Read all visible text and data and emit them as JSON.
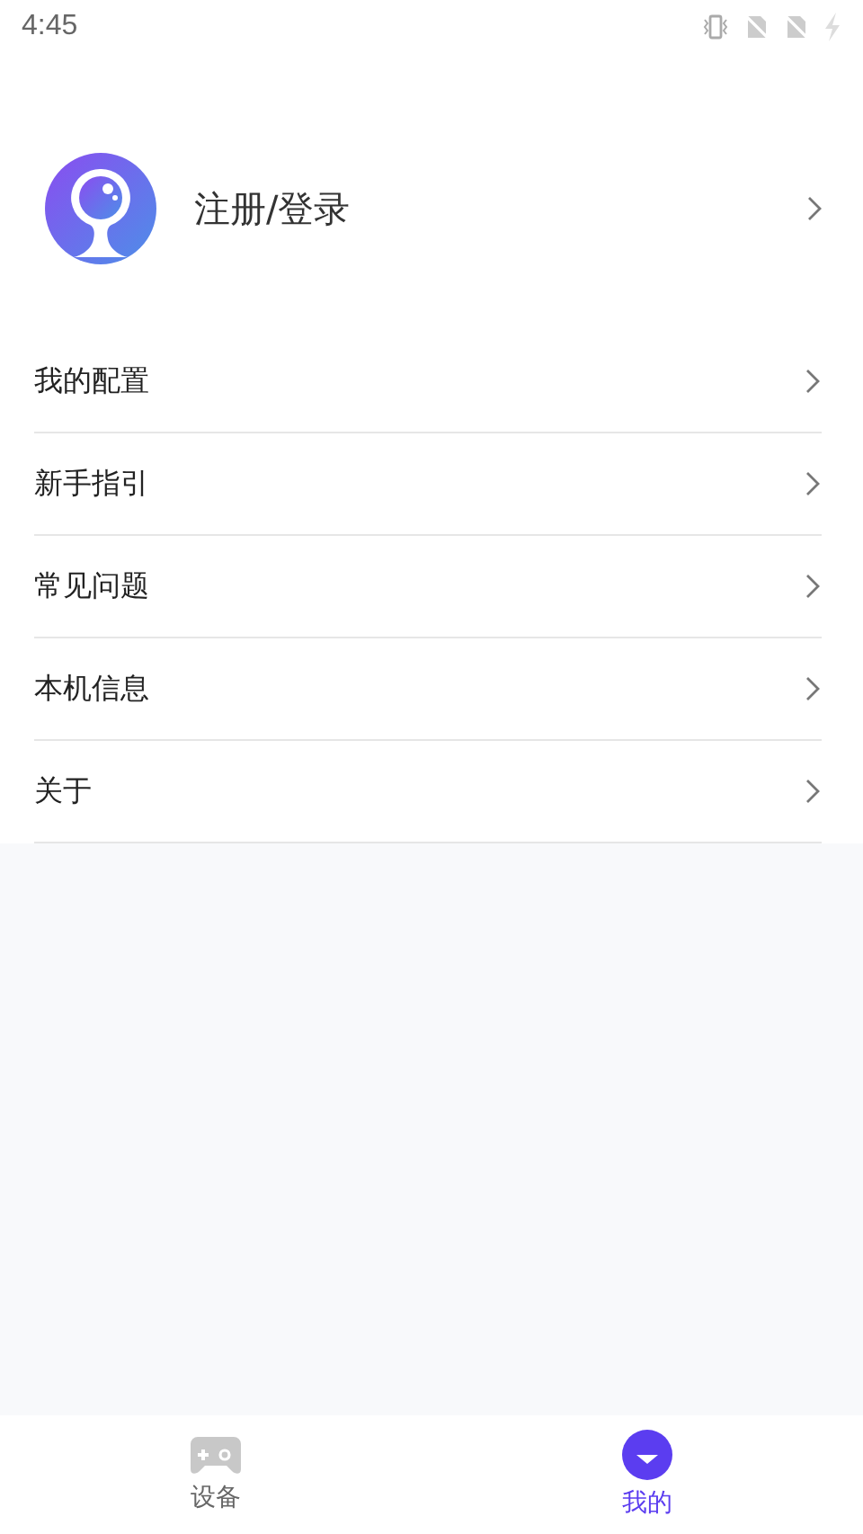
{
  "status_bar": {
    "time": "4:45"
  },
  "profile": {
    "label": "注册/登录"
  },
  "menu": [
    {
      "label": "我的配置"
    },
    {
      "label": "新手指引"
    },
    {
      "label": "常见问题"
    },
    {
      "label": "本机信息"
    },
    {
      "label": "关于"
    }
  ],
  "tabs": [
    {
      "label": "设备",
      "kind": "device",
      "selected": false
    },
    {
      "label": "我的",
      "kind": "me",
      "selected": true
    }
  ]
}
